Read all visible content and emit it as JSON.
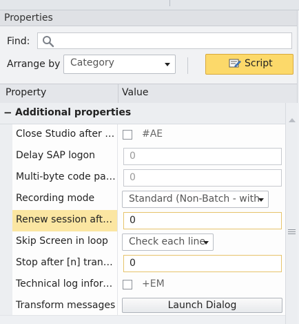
{
  "panel": {
    "title": "Properties"
  },
  "find": {
    "label": "Find:",
    "value": ""
  },
  "arrange": {
    "label": "Arrange by",
    "selected": "Category"
  },
  "script_button": {
    "label": "Script"
  },
  "grid": {
    "col_property": "Property",
    "col_value": "Value",
    "category": "Additional properties",
    "rows": [
      {
        "name": "Close Studio after run",
        "type": "checkbox",
        "checked": false,
        "value": "#AE"
      },
      {
        "name": "Delay SAP logon",
        "type": "text",
        "value": "0"
      },
      {
        "name": "Multi-byte code pag...",
        "type": "text",
        "value": "0"
      },
      {
        "name": "Recording mode",
        "type": "dropdown",
        "value": "Standard (Non-Batch - with"
      },
      {
        "name": "Renew session after...",
        "type": "text",
        "value": "0",
        "selected": true
      },
      {
        "name": "Skip Screen in loop",
        "type": "dropdown",
        "value": "Check each line"
      },
      {
        "name": "Stop after [n] transa...",
        "type": "text",
        "value": "0",
        "active": true
      },
      {
        "name": "Technical log inform...",
        "type": "checkbox",
        "checked": false,
        "value": "+EM"
      },
      {
        "name": "Transform messages",
        "type": "button",
        "value": "Launch Dialog"
      }
    ]
  },
  "colors": {
    "selected_row": "#fbe6a2",
    "script_button": "#fcd96a",
    "input_focus_border": "#e6c36a"
  },
  "icons": {
    "find": "search-icon",
    "script": "script-icon"
  }
}
